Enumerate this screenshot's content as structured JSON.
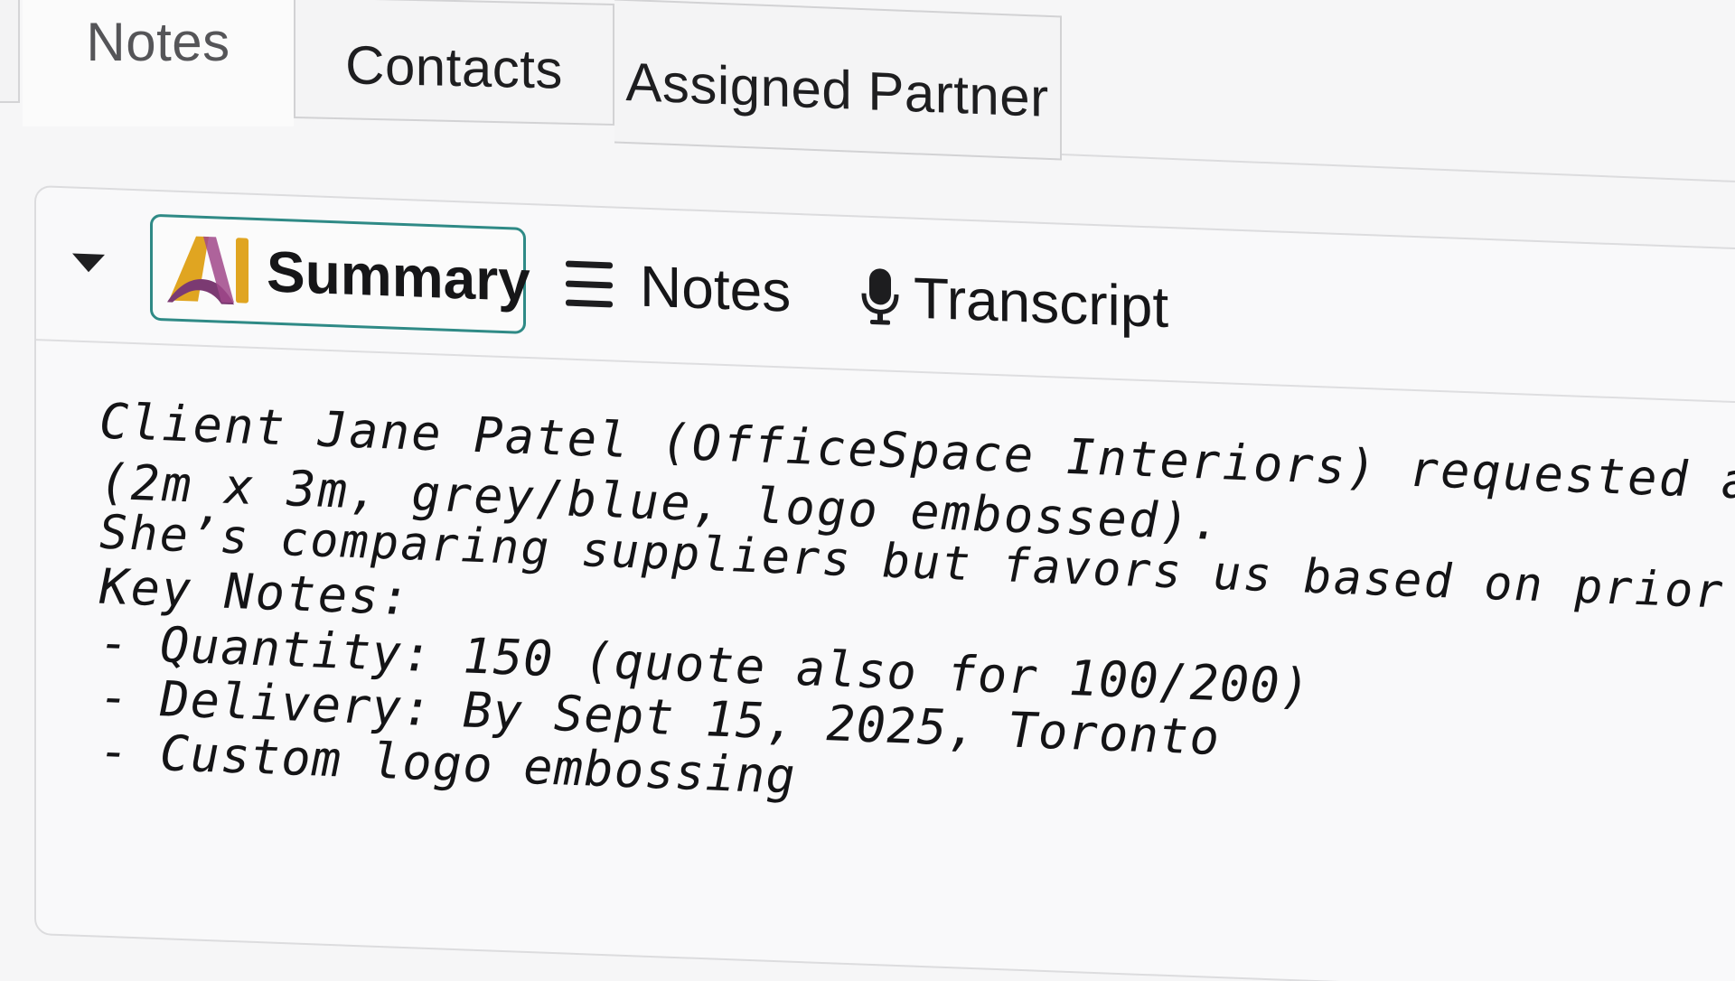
{
  "tabs": {
    "notes_label": "Notes",
    "contacts_label": "Contacts",
    "partner_label": "Assigned Partner"
  },
  "toolbar": {
    "summary_label": "Summary",
    "notes_label": "Notes",
    "transcript_label": "Transcript"
  },
  "colors": {
    "active_border": "#2f8a86",
    "logo_gold": "#e0a521",
    "logo_plum": "#7b3a72"
  },
  "icons": {
    "collapse": "caret-down-icon",
    "summary": "ai-logo-icon",
    "notes": "menu-lines-icon",
    "transcript": "microphone-icon"
  },
  "note": {
    "lines": [
      "Client Jane Patel (OfficeSpace Interiors) requested a quote for",
      "(2m x 3m, grey/blue, logo embossed).",
      "She’s comparing suppliers but favors us based on prior experien",
      "Key Notes:",
      "- Quantity: 150 (quote also for 100/200)",
      "- Delivery: By Sept 15, 2025, Toronto",
      "- Custom logo embossing"
    ]
  }
}
